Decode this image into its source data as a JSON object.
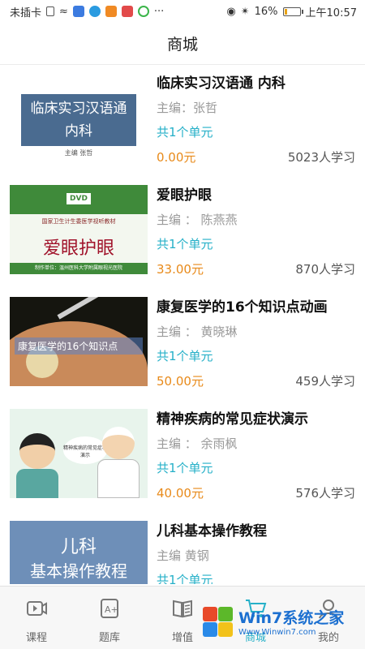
{
  "status_bar": {
    "carrier": "未插卡",
    "more": "···",
    "battery": "16%",
    "battery_level": 0.16,
    "time": "上午10:57"
  },
  "header": {
    "title": "商城"
  },
  "courses": [
    {
      "title": "临床实习汉语通 内科",
      "editor": "主编：张哲",
      "units": "共1个单元",
      "price": "0.00元",
      "learners": "5023人学习",
      "thumb": {
        "line1": "临床实习汉语通",
        "line2": "内科",
        "sub": "主编  张哲"
      }
    },
    {
      "title": "爱眼护眼",
      "editor": "主编 ： 陈燕燕",
      "units": "共1个单元",
      "price": "33.00元",
      "learners": "870人学习",
      "thumb": {
        "badge": "DVD",
        "line": "国家卫生计生委医学视听教材",
        "big": "爱眼护眼",
        "foot": "制作单位：温州医科大学附属眼视光医院"
      }
    },
    {
      "title": "康复医学的16个知识点动画",
      "editor": "主编 ： 黄晓琳",
      "units": "共1个单元",
      "price": "50.00元",
      "learners": "459人学习",
      "thumb": {
        "label": "康复医学的16个知识点"
      }
    },
    {
      "title": "精神疾病的常见症状演示",
      "editor": "主编 ： 余雨枫",
      "units": "共1个单元",
      "price": "40.00元",
      "learners": "576人学习",
      "thumb": {
        "bubble": "精神疾病的常见症状演示"
      }
    },
    {
      "title": "儿科基本操作教程",
      "editor": "主编 黄钢",
      "units": "共1个单元",
      "price": "",
      "learners": "",
      "thumb": {
        "line1": "儿科",
        "line2": "基本操作教程"
      }
    }
  ],
  "bottom_nav": {
    "items": [
      {
        "label": "课程",
        "icon": "course-icon"
      },
      {
        "label": "题库",
        "icon": "question-bank-icon"
      },
      {
        "label": "增值",
        "icon": "book-icon"
      },
      {
        "label": "商城",
        "icon": "cart-icon"
      },
      {
        "label": "我的",
        "icon": "profile-icon"
      }
    ],
    "active_index": 3
  },
  "watermark": {
    "main": "Win7系统之家",
    "url": "Www.Winwin7.com"
  },
  "colors": {
    "accent": "#26b0c8",
    "price": "#e88a1a"
  }
}
